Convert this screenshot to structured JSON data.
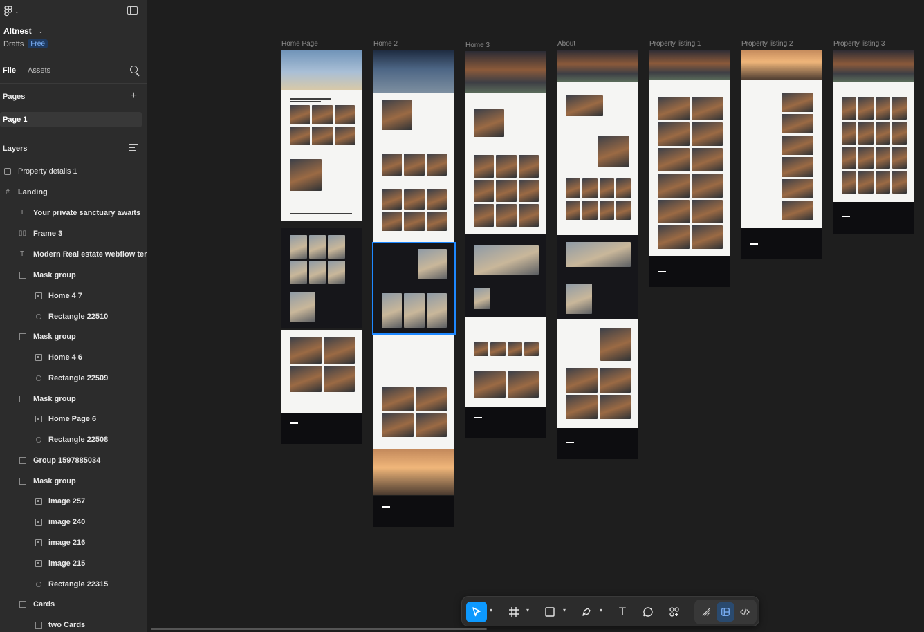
{
  "app": {
    "project_name": "Altnest",
    "location": "Drafts",
    "plan_badge": "Free"
  },
  "panel": {
    "tabs": [
      "File",
      "Assets"
    ],
    "pages_title": "Pages",
    "pages": [
      "Page 1"
    ],
    "layers_title": "Layers",
    "layers": [
      {
        "label": "Property details 1",
        "icon": "frame-icon"
      },
      {
        "label": "Landing",
        "icon": "hash-frame-icon"
      },
      {
        "label": "Your private sanctuary awaits",
        "icon": "text-icon"
      },
      {
        "label": "Frame 3",
        "icon": "auto-layout-icon"
      },
      {
        "label": "Modern Real estate webflow temp",
        "icon": "text-icon"
      },
      {
        "label": "Mask group",
        "icon": "mask-icon"
      },
      {
        "label": "Home 4 7",
        "icon": "image-icon"
      },
      {
        "label": "Rectangle 22510",
        "icon": "rectangle-mask-icon"
      },
      {
        "label": "Mask group",
        "icon": "mask-icon"
      },
      {
        "label": "Home 4 6",
        "icon": "image-icon"
      },
      {
        "label": "Rectangle 22509",
        "icon": "rectangle-mask-icon"
      },
      {
        "label": "Mask group",
        "icon": "mask-icon"
      },
      {
        "label": "Home Page 6",
        "icon": "image-icon"
      },
      {
        "label": "Rectangle 22508",
        "icon": "rectangle-mask-icon"
      },
      {
        "label": "Group 1597885034",
        "icon": "group-icon"
      },
      {
        "label": "Mask group",
        "icon": "mask-icon"
      },
      {
        "label": "image 257",
        "icon": "image-icon"
      },
      {
        "label": "image 240",
        "icon": "image-icon"
      },
      {
        "label": "image 216",
        "icon": "image-icon"
      },
      {
        "label": "image 215",
        "icon": "image-icon"
      },
      {
        "label": "Rectangle 22315",
        "icon": "rectangle-mask-icon"
      },
      {
        "label": "Cards",
        "icon": "group-icon"
      },
      {
        "label": "two Cards",
        "icon": "group-icon"
      }
    ]
  },
  "canvas": {
    "frames": [
      {
        "label": "Home Page"
      },
      {
        "label": "Home 2"
      },
      {
        "label": "Home 3"
      },
      {
        "label": "About"
      },
      {
        "label": "Property listing 1"
      },
      {
        "label": "Property listing 2"
      },
      {
        "label": "Property listing 3"
      }
    ]
  },
  "toolbar": {
    "tools": [
      "move-tool",
      "frame-tool",
      "shape-tool",
      "pen-tool",
      "text-tool",
      "comment-tool",
      "actions-tool"
    ],
    "modes": [
      "draw-mode",
      "design-mode",
      "dev-mode"
    ],
    "accent": "#0d99ff"
  },
  "colors": {
    "panel_bg": "#2c2c2c",
    "canvas_bg": "#1e1e1e",
    "selection": "#1e88ff"
  }
}
